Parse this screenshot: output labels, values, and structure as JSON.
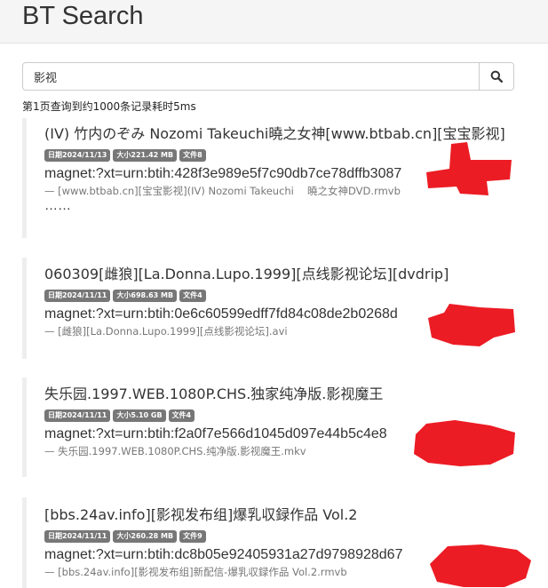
{
  "app": {
    "title": "BT Search"
  },
  "search": {
    "value": "影视",
    "placeholder": ""
  },
  "stats_text": "第1页查询到约1000条记录耗时5ms",
  "results": [
    {
      "title": "(IV) 竹内のぞみ Nozomi Takeuchi曉之女神[www.btbab.cn][宝宝影视]",
      "date": "日期2024/11/13",
      "size": "大小221.42 MB",
      "files": "文件8",
      "magnet": "magnet:?xt=urn:btih:428f3e989e5f7c90db7ce78dffb3087",
      "file": "— [www.btbab.cn][宝宝影视](IV) Nozomi Takeuchi　 曉之女神DVD.rmvb",
      "more": "……"
    },
    {
      "title": "060309[雌狼][La.Donna.Lupo.1999][点线影视论坛][dvdrip]",
      "date": "日期2024/11/11",
      "size": "大小698.63 MB",
      "files": "文件4",
      "magnet": "magnet:?xt=urn:btih:0e6c60599edff7fd84c08de2b0268d",
      "file": "— [雌狼][La.Donna.Lupo.1999][点线影视论坛].avi"
    },
    {
      "title": "失乐园.1997.WEB.1080P.CHS.独家纯净版.影视魔王",
      "date": "日期2024/11/11",
      "size": "大小5.10 GB",
      "files": "文件4",
      "magnet": "magnet:?xt=urn:btih:f2a0f7e566d1045d097e44b5c4e8",
      "file": "— 失乐园.1997.WEB.1080P.CHS.纯净版.影视魔王.mkv"
    },
    {
      "title": "[bbs.24av.info][影视发布组]爆乳収録作品 Vol.2",
      "date": "日期2024/11/11",
      "size": "大小260.28 MB",
      "files": "文件9",
      "magnet": "magnet:?xt=urn:btih:dc8b05e92405931a27d9798928d67",
      "file": "— [bbs.24av.info][影视发布组]新配信-爆乳収録作品 Vol.2.rmvb"
    }
  ],
  "colors": {
    "header_bg": "#f5f5f5",
    "badge_bg": "#777777",
    "redaction": "#ec1c24",
    "result_border": "#eeeeee"
  },
  "icons": {
    "search_button": "search-icon"
  }
}
